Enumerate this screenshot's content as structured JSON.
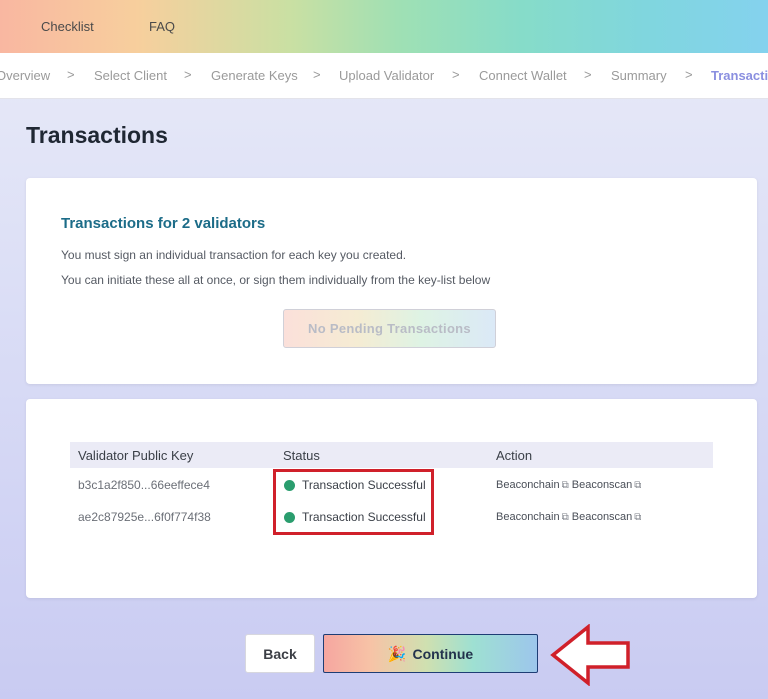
{
  "topnav": {
    "links": [
      "Checklist",
      "FAQ"
    ]
  },
  "steps": {
    "items": [
      "Overview",
      "Select Client",
      "Generate Keys",
      "Upload Validator",
      "Connect Wallet",
      "Summary",
      "Transactions"
    ],
    "separator": ">",
    "active": "Transactions"
  },
  "page": {
    "title": "Transactions"
  },
  "summary_card": {
    "heading": "Transactions for 2 validators",
    "line1": "You must sign an individual transaction for each key you created.",
    "line2": "You can initiate these all at once, or sign them individually from the key-list below",
    "button_label": "No Pending Transactions"
  },
  "table": {
    "headers": [
      "Validator Public Key",
      "Status",
      "Action"
    ],
    "rows": [
      {
        "key": "b3c1a2f850...66eeffece4",
        "status": "Transaction Successful",
        "actions": [
          "Beaconchain",
          "Beaconscan"
        ]
      },
      {
        "key": "ae2c87925e...6f0f774f38",
        "status": "Transaction Successful",
        "actions": [
          "Beaconchain",
          "Beaconscan"
        ]
      }
    ],
    "status_color": "#2a9d6e",
    "external_link_icon": "external-link-icon"
  },
  "footer": {
    "back_label": "Back",
    "continue_label": "Continue",
    "continue_icon": "party-popper-icon"
  },
  "annotations": {
    "highlight_color": "#d0202a",
    "arrow_icon": "left-arrow-icon"
  }
}
